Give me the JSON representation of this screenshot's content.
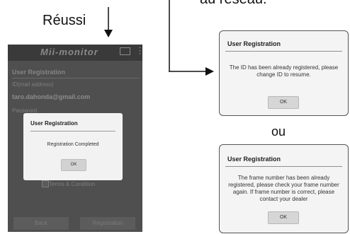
{
  "labels": {
    "success": "Réussi",
    "top_right": "au réseau.",
    "or": "ou"
  },
  "phone": {
    "app_name": "Mii-monitor",
    "screen_title": "User Registration",
    "id_label": "ID(mail address)",
    "id_value": "taro.dahonda@gmail.com",
    "password_label": "Password",
    "terms_label": "Terms & Condition",
    "back_button": "Back",
    "register_button": "Registration",
    "dialog": {
      "title": "User Registration",
      "message": "Registration Completed",
      "ok": "OK"
    }
  },
  "dialog_already_registered": {
    "title": "User Registration",
    "message_line1": "The ID has been already registered, please",
    "message_line2": "change ID to resume.",
    "ok": "OK"
  },
  "dialog_frame_number": {
    "title": "User Registration",
    "message_line1": "The frame number has been already",
    "message_line2": "registered, please check your frame number",
    "message_line3": "again. If frame number is correct, please",
    "message_line4": "contact your dealer",
    "ok": "OK"
  },
  "colors": {
    "arrow": "#111111",
    "phone_bg": "#4f4f4f",
    "dialog_bg": "#f4f4f4"
  }
}
